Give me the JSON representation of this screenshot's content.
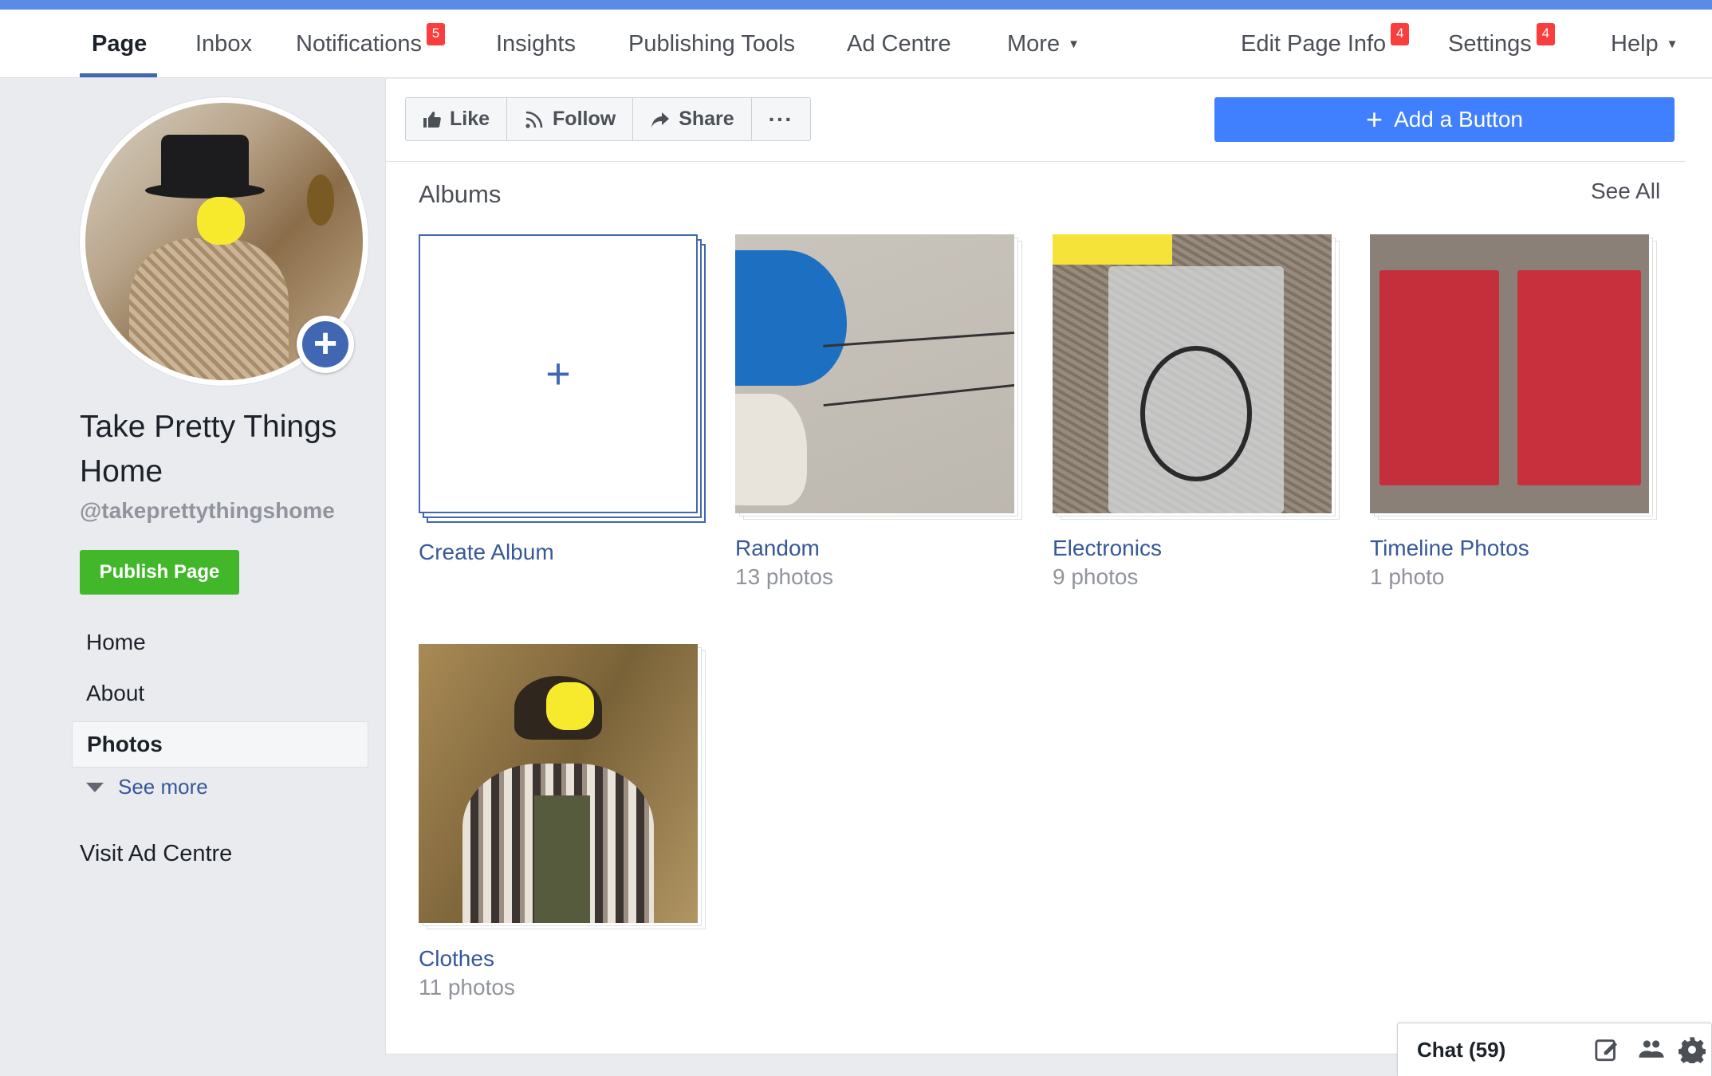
{
  "colors": {
    "accent": "#4267b2",
    "blue_button": "#4080ff",
    "green": "#42b72a",
    "badge": "#fa3e3e",
    "link": "#365899"
  },
  "topnav": {
    "left": [
      {
        "label": "Page",
        "active": true
      },
      {
        "label": "Inbox"
      },
      {
        "label": "Notifications",
        "badge": "5"
      },
      {
        "label": "Insights"
      },
      {
        "label": "Publishing Tools"
      },
      {
        "label": "Ad Centre"
      },
      {
        "label": "More"
      }
    ],
    "right": [
      {
        "label": "Edit Page Info",
        "badge": "4"
      },
      {
        "label": "Settings",
        "badge": "4"
      },
      {
        "label": "Help"
      }
    ]
  },
  "sidebar": {
    "page_name": "Take Pretty Things Home",
    "handle": "@takeprettythingshome",
    "publish_label": "Publish Page",
    "items": [
      {
        "label": "Home"
      },
      {
        "label": "About"
      },
      {
        "label": "Photos",
        "active": true
      }
    ],
    "see_more": "See more",
    "visit_ad": "Visit Ad Centre"
  },
  "actions": {
    "like": "Like",
    "follow": "Follow",
    "share": "Share",
    "more": "···",
    "add_button": "Add a Button",
    "add_button_icon": "+"
  },
  "albums": {
    "title": "Albums",
    "see_all": "See All",
    "create": {
      "label": "Create Album",
      "icon": "+"
    },
    "list": [
      {
        "name": "Random",
        "count": "13 photos"
      },
      {
        "name": "Electronics",
        "count": "9 photos"
      },
      {
        "name": "Timeline Photos",
        "count": "1 photo"
      },
      {
        "name": "Clothes",
        "count": "11 photos"
      }
    ]
  },
  "chat": {
    "label": "Chat (59)"
  }
}
